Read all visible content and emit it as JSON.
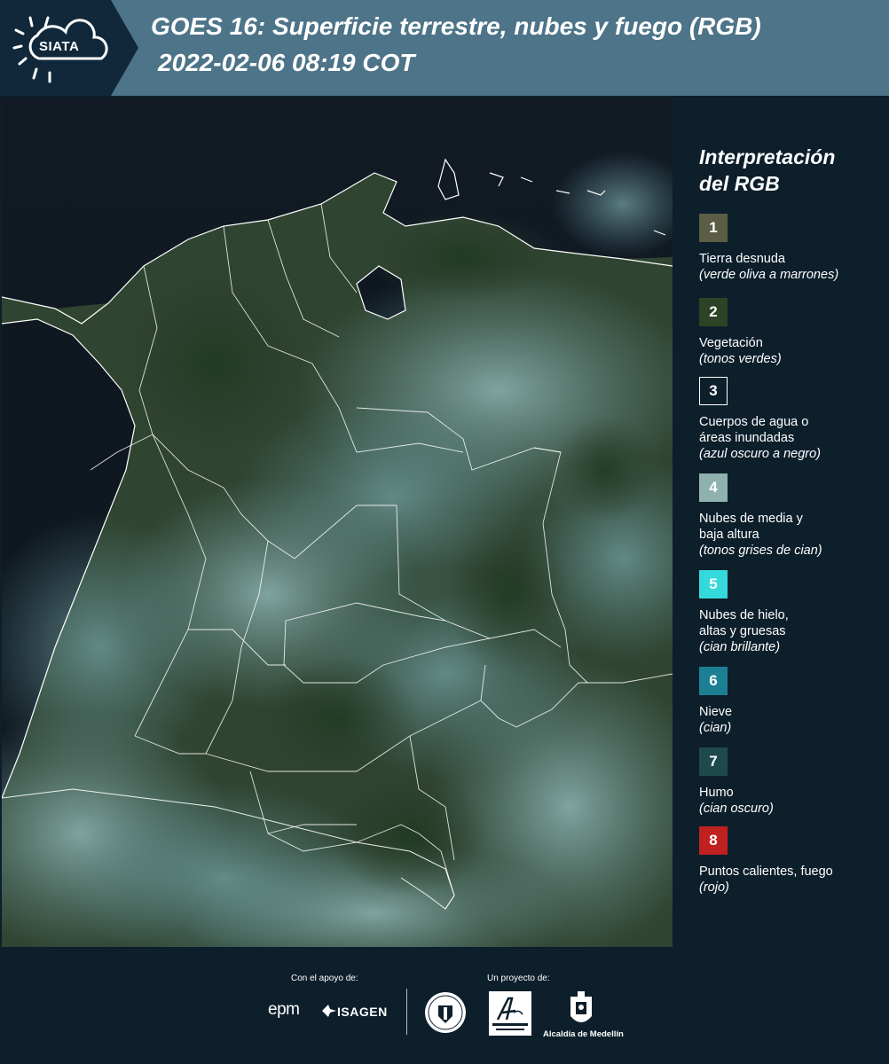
{
  "header": {
    "logo_text": "SIATA",
    "title_line1": "GOES 16: Superficie terrestre, nubes y fuego (RGB)",
    "title_line2": "2022-02-06 08:19 COT"
  },
  "map": {
    "image_description_icon": "satellite-rgb-map",
    "colors": {
      "ocean": "#0f1820",
      "vegetation": "#2b3d2b",
      "cloud": "#5f8e92",
      "boundary": "#ffffff"
    }
  },
  "legend": {
    "title_line1": "Interpretación",
    "title_line2": "del RGB",
    "items": [
      {
        "number": "1",
        "label_lines": [
          "Tierra desnuda"
        ],
        "desc": "(verde oliva a marrones)",
        "color": "#5b5e44",
        "border": ""
      },
      {
        "number": "2",
        "label_lines": [
          "Vegetación"
        ],
        "desc": "(tonos verdes)",
        "color": "#2d4326",
        "border": ""
      },
      {
        "number": "3",
        "label_lines": [
          "Cuerpos de agua o",
          "áreas inundadas"
        ],
        "desc": "(azul oscuro a negro)",
        "color": "#0d1f2b",
        "border": "#ffffff"
      },
      {
        "number": "4",
        "label_lines": [
          "Nubes de media y",
          "baja altura"
        ],
        "desc": "(tonos grises de cian)",
        "color": "#8fb1b0",
        "border": ""
      },
      {
        "number": "5",
        "label_lines": [
          "Nubes de hielo,",
          "altas y gruesas"
        ],
        "desc": "(cian brillante)",
        "color": "#35d9dc",
        "border": ""
      },
      {
        "number": "6",
        "label_lines": [
          "Nieve"
        ],
        "desc": "(cian)",
        "color": "#1d7f94",
        "border": ""
      },
      {
        "number": "7",
        "label_lines": [
          "Humo"
        ],
        "desc": "(cian oscuro)",
        "color": "#1e4a4b",
        "border": ""
      },
      {
        "number": "8",
        "label_lines": [
          "Puntos calientes, fuego"
        ],
        "desc": "(rojo)",
        "color": "#c0201f",
        "border": ""
      }
    ]
  },
  "footer": {
    "support_caption": "Con el apoyo de:",
    "project_caption": "Un proyecto de:",
    "sponsors": [
      "epm",
      "ISAGEN"
    ],
    "alcaldia": "Alcaldía de Medellín"
  }
}
